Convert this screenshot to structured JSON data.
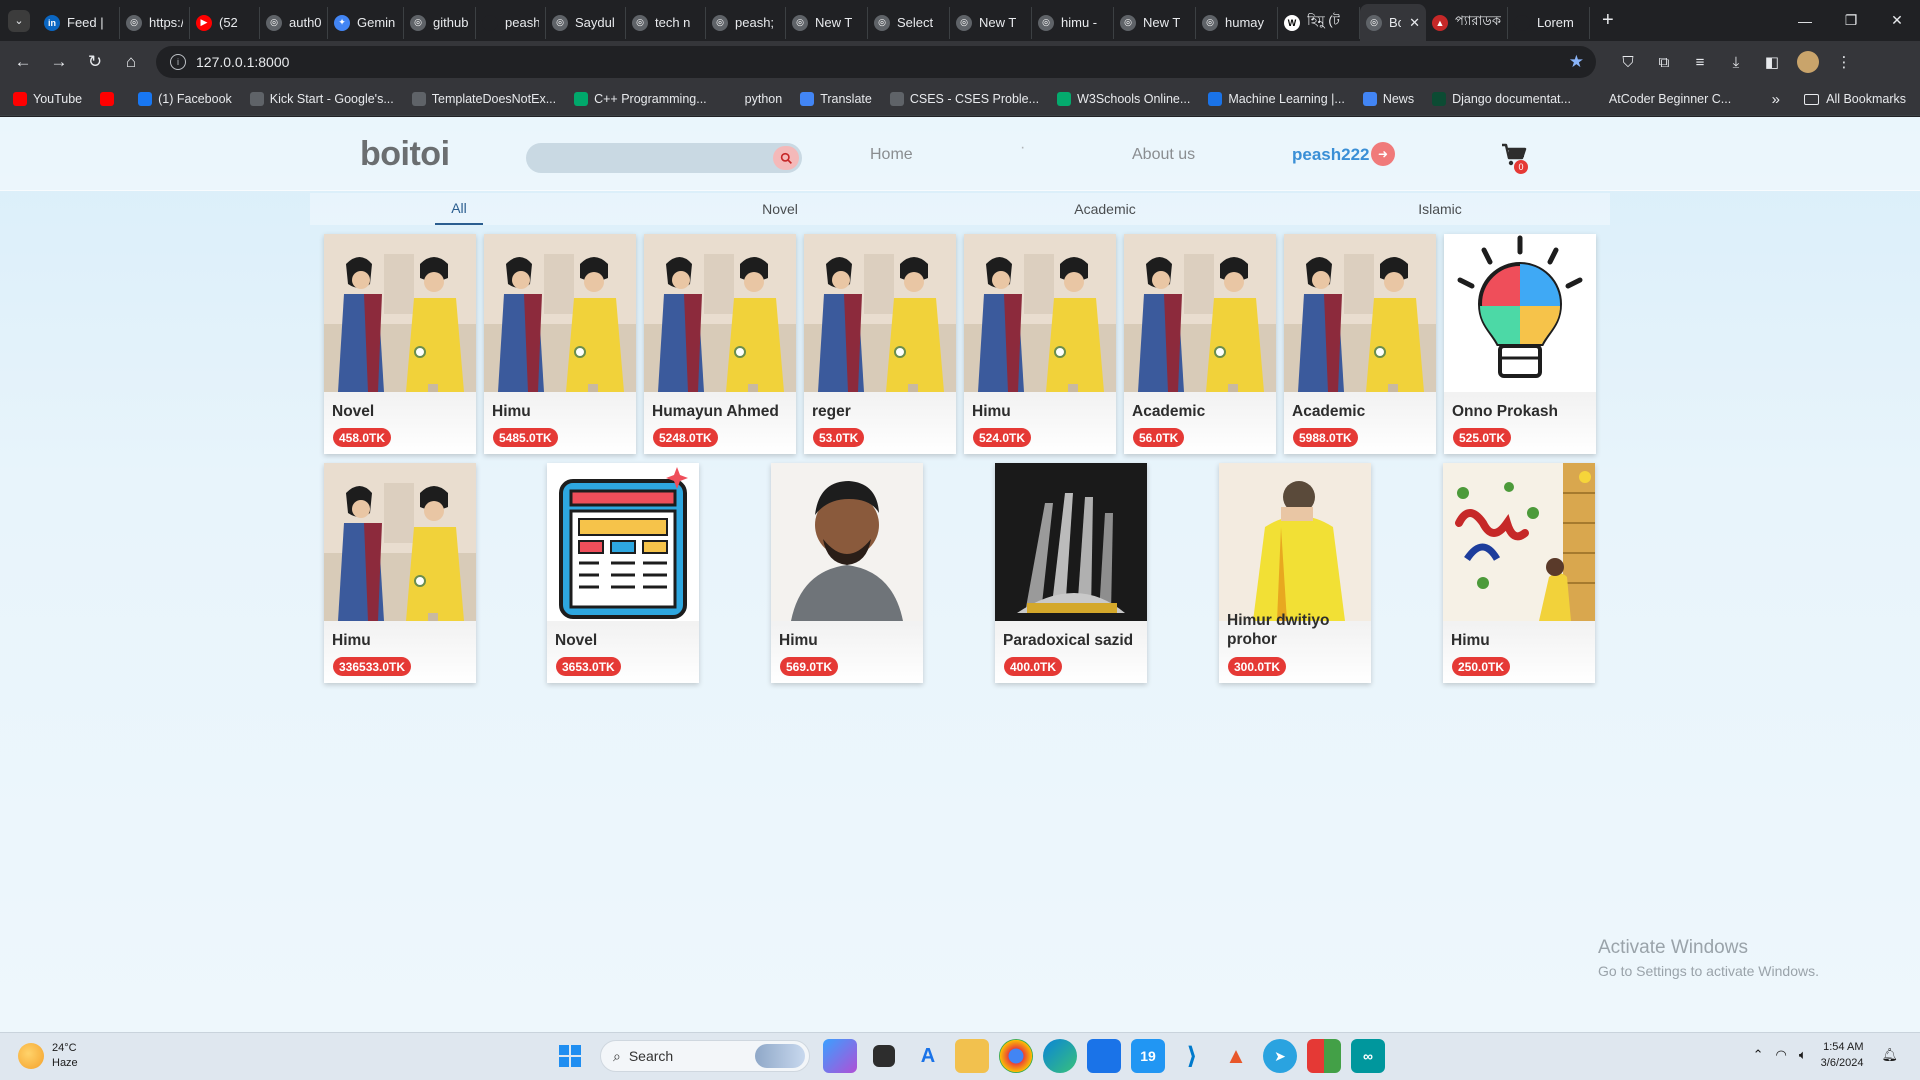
{
  "browser": {
    "tabs": [
      {
        "label": "Feed |",
        "color": "#0a66c2",
        "glyph": "in",
        "width": 82
      },
      {
        "label": "https:/",
        "color": "#5f6368",
        "glyph": "◎",
        "width": 70
      },
      {
        "label": "(52",
        "color": "#ff0000",
        "glyph": "▶",
        "width": 70
      },
      {
        "label": "auth0",
        "color": "#5f6368",
        "glyph": "◎",
        "width": 68
      },
      {
        "label": "Gemin",
        "color": "#4285f4",
        "glyph": "✦",
        "width": 76
      },
      {
        "label": "github",
        "color": "#5f6368",
        "glyph": "◎",
        "width": 72
      },
      {
        "label": "peash",
        "color": "#202124",
        "glyph": "",
        "width": 70
      },
      {
        "label": "Saydul",
        "color": "#5f6368",
        "glyph": "◎",
        "width": 80
      },
      {
        "label": "tech n",
        "color": "#5f6368",
        "glyph": "◎",
        "width": 80
      },
      {
        "label": "peash;",
        "color": "#5f6368",
        "glyph": "◎",
        "width": 80
      },
      {
        "label": "New T",
        "color": "#5f6368",
        "glyph": "◎",
        "width": 82
      },
      {
        "label": "Select",
        "color": "#5f6368",
        "glyph": "◎",
        "width": 82
      },
      {
        "label": "New T",
        "color": "#5f6368",
        "glyph": "◎",
        "width": 82
      },
      {
        "label": "himu -",
        "color": "#5f6368",
        "glyph": "◎",
        "width": 82
      },
      {
        "label": "New T",
        "color": "#5f6368",
        "glyph": "◎",
        "width": 82
      },
      {
        "label": "humay",
        "color": "#5f6368",
        "glyph": "◎",
        "width": 82
      },
      {
        "label": "হিমু (ট",
        "color": "#ffffff",
        "glyph": "W",
        "width": 82
      },
      {
        "label": "Bc",
        "color": "#5f6368",
        "glyph": "◎",
        "width": 66,
        "active": true
      },
      {
        "label": "প্যারাডক",
        "color": "#c62828",
        "glyph": "▲",
        "width": 82
      },
      {
        "label": "Lorem",
        "color": "#202124",
        "glyph": "",
        "width": 82
      }
    ],
    "url": "127.0.0.1:8000",
    "bookmarks": [
      {
        "label": "YouTube",
        "color": "#ff0000"
      },
      {
        "label": "",
        "color": "#ff0000"
      },
      {
        "label": "(1) Facebook",
        "color": "#1877f2"
      },
      {
        "label": "Kick Start - Google's...",
        "color": "#5f6368"
      },
      {
        "label": "TemplateDoesNotEx...",
        "color": "#5f6368"
      },
      {
        "label": "C++ Programming...",
        "color": "#00a86b"
      },
      {
        "label": "python",
        "color": "#35363a"
      },
      {
        "label": "Translate",
        "color": "#4285f4"
      },
      {
        "label": "CSES - CSES Proble...",
        "color": "#5f6368"
      },
      {
        "label": "W3Schools Online...",
        "color": "#04aa6d"
      },
      {
        "label": "Machine Learning |...",
        "color": "#1a73e8"
      },
      {
        "label": "News",
        "color": "#4285f4"
      },
      {
        "label": "Django documentat...",
        "color": "#0c4b33"
      },
      {
        "label": "AtCoder Beginner C...",
        "color": "#35363a"
      }
    ],
    "all_bookmarks": "All Bookmarks"
  },
  "site": {
    "logo": "boitoi",
    "nav": {
      "home": "Home",
      "dot": "·",
      "about": "About us",
      "user": "peash222"
    },
    "cart_count": "0",
    "categories": [
      "All",
      "Novel",
      "Academic",
      "Islamic"
    ],
    "active_category": "All"
  },
  "books": [
    {
      "title": "Novel",
      "price": "458.0TK",
      "cover": "couple"
    },
    {
      "title": "Himu",
      "price": "5485.0TK",
      "cover": "couple"
    },
    {
      "title": "Humayun Ahmed",
      "price": "5248.0TK",
      "cover": "couple"
    },
    {
      "title": "reger",
      "price": "53.0TK",
      "cover": "couple"
    },
    {
      "title": "Himu",
      "price": "524.0TK",
      "cover": "couple"
    },
    {
      "title": "Academic",
      "price": "56.0TK",
      "cover": "couple"
    },
    {
      "title": "Academic",
      "price": "5988.0TK",
      "cover": "couple"
    },
    {
      "title": "Onno Prokash",
      "price": "525.0TK",
      "cover": "bulb"
    },
    {
      "title": "Himu",
      "price": "336533.0TK",
      "cover": "couple"
    },
    {
      "title": "Novel",
      "price": "3653.0TK",
      "cover": "calc"
    },
    {
      "title": "Himu",
      "price": "569.0TK",
      "cover": "person"
    },
    {
      "title": "Paradoxical sazid",
      "price": "400.0TK",
      "cover": "hand"
    },
    {
      "title": "Himur dwitiyo prohor",
      "price": "300.0TK",
      "cover": "yellow"
    },
    {
      "title": "Himu",
      "price": "250.0TK",
      "cover": "art"
    }
  ],
  "watermark": {
    "line1": "Activate Windows",
    "line2": "Go to Settings to activate Windows."
  },
  "taskbar": {
    "temp": "24°C",
    "weather": "Haze",
    "search": "Search",
    "time": "1:54 AM",
    "date": "3/6/2024"
  }
}
